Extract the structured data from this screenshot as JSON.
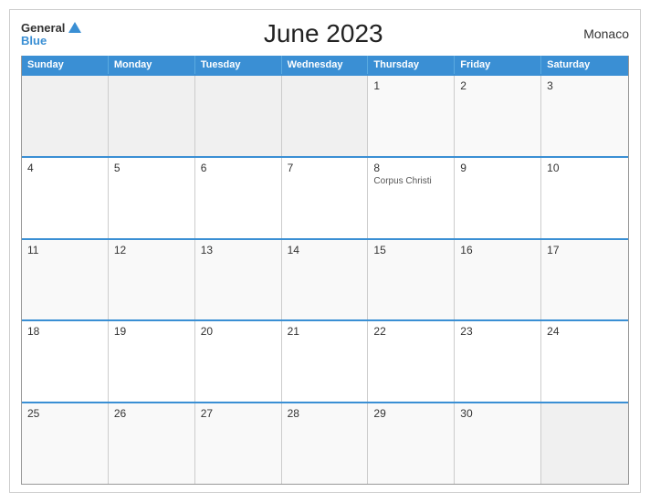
{
  "header": {
    "logo_general": "General",
    "logo_blue": "Blue",
    "title": "June 2023",
    "country": "Monaco"
  },
  "day_headers": [
    "Sunday",
    "Monday",
    "Tuesday",
    "Wednesday",
    "Thursday",
    "Friday",
    "Saturday"
  ],
  "weeks": [
    [
      {
        "day": "",
        "empty": true
      },
      {
        "day": "",
        "empty": true
      },
      {
        "day": "",
        "empty": true
      },
      {
        "day": "",
        "empty": true
      },
      {
        "day": "1",
        "empty": false
      },
      {
        "day": "2",
        "empty": false
      },
      {
        "day": "3",
        "empty": false
      }
    ],
    [
      {
        "day": "4",
        "empty": false
      },
      {
        "day": "5",
        "empty": false
      },
      {
        "day": "6",
        "empty": false
      },
      {
        "day": "7",
        "empty": false
      },
      {
        "day": "8",
        "empty": false,
        "holiday": "Corpus Christi"
      },
      {
        "day": "9",
        "empty": false
      },
      {
        "day": "10",
        "empty": false
      }
    ],
    [
      {
        "day": "11",
        "empty": false
      },
      {
        "day": "12",
        "empty": false
      },
      {
        "day": "13",
        "empty": false
      },
      {
        "day": "14",
        "empty": false
      },
      {
        "day": "15",
        "empty": false
      },
      {
        "day": "16",
        "empty": false
      },
      {
        "day": "17",
        "empty": false
      }
    ],
    [
      {
        "day": "18",
        "empty": false
      },
      {
        "day": "19",
        "empty": false
      },
      {
        "day": "20",
        "empty": false
      },
      {
        "day": "21",
        "empty": false
      },
      {
        "day": "22",
        "empty": false
      },
      {
        "day": "23",
        "empty": false
      },
      {
        "day": "24",
        "empty": false
      }
    ],
    [
      {
        "day": "25",
        "empty": false
      },
      {
        "day": "26",
        "empty": false
      },
      {
        "day": "27",
        "empty": false
      },
      {
        "day": "28",
        "empty": false
      },
      {
        "day": "29",
        "empty": false
      },
      {
        "day": "30",
        "empty": false
      },
      {
        "day": "",
        "empty": true
      }
    ]
  ]
}
